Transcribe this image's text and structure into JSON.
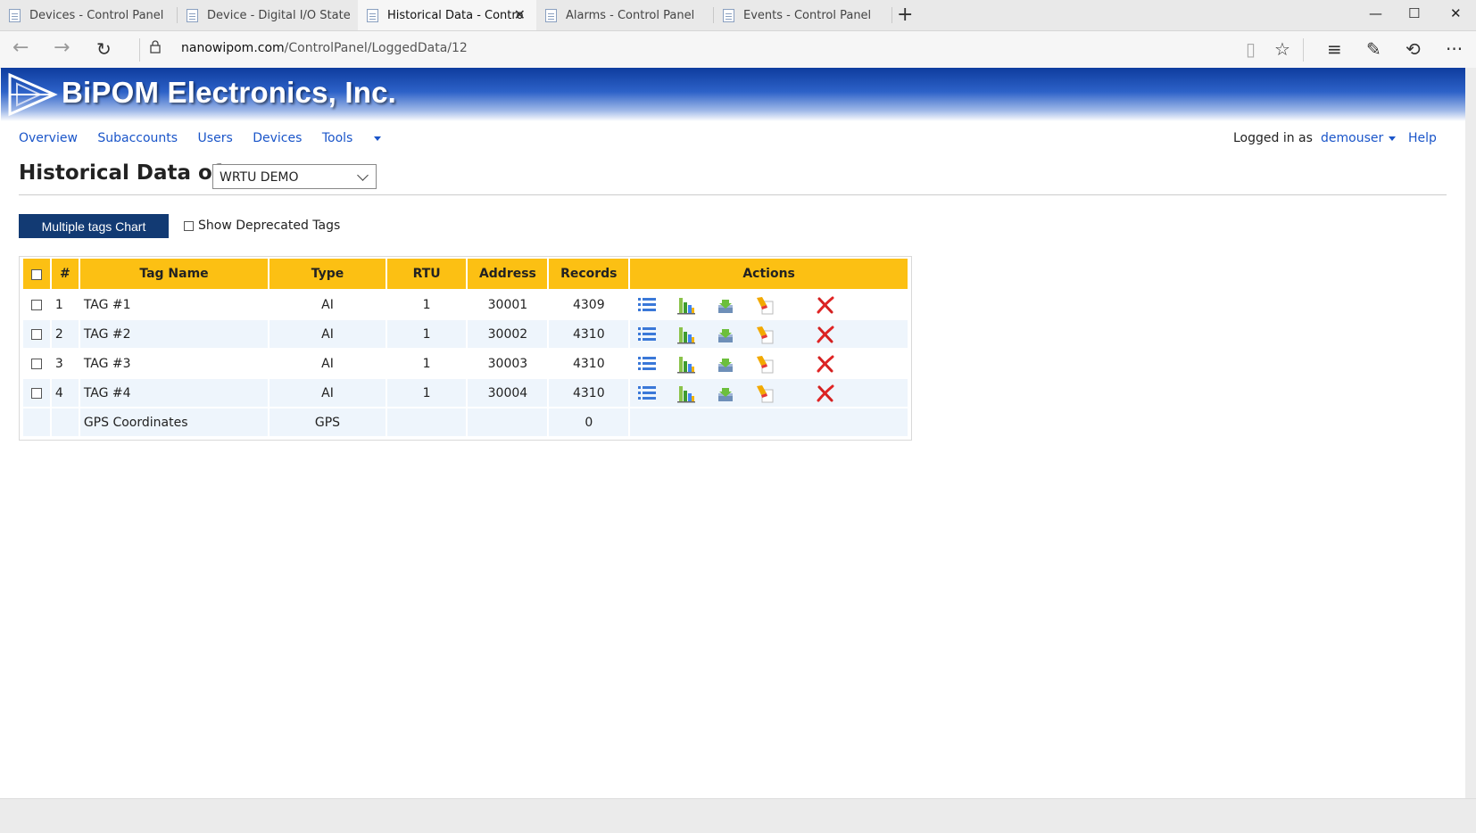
{
  "browser": {
    "tabs": [
      {
        "title": "Devices - Control Panel",
        "active": false
      },
      {
        "title": "Device - Digital I/O State",
        "active": false
      },
      {
        "title": "Historical Data - Contro",
        "active": true
      },
      {
        "title": "Alarms - Control Panel",
        "active": false
      },
      {
        "title": "Events - Control Panel",
        "active": false
      }
    ],
    "url_host": "nanowipom.com",
    "url_path": "/ControlPanel/LoggedData/12"
  },
  "banner": {
    "title": "BiPOM Electronics, Inc.",
    "colors": {
      "dark": "#0e3c9e",
      "mid": "#2d62c8"
    }
  },
  "nav": {
    "items": [
      "Overview",
      "Subaccounts",
      "Users",
      "Devices",
      "Tools"
    ],
    "logged_in_label": "Logged in as",
    "user": "demouser",
    "help": "Help"
  },
  "page": {
    "title": "Historical Data of",
    "device_select": "WRTU DEMO",
    "multi_chart_button": "Multiple tags Chart",
    "deprecated_label": "Show Deprecated Tags"
  },
  "table": {
    "headers": [
      "#",
      "Tag Name",
      "Type",
      "RTU",
      "Address",
      "Records",
      "Actions"
    ],
    "rows": [
      {
        "num": "1",
        "name": "TAG #1",
        "type": "AI",
        "rtu": "1",
        "address": "30001",
        "records": "4309"
      },
      {
        "num": "2",
        "name": "TAG #2",
        "type": "AI",
        "rtu": "1",
        "address": "30002",
        "records": "4310"
      },
      {
        "num": "3",
        "name": "TAG #3",
        "type": "AI",
        "rtu": "1",
        "address": "30003",
        "records": "4310"
      },
      {
        "num": "4",
        "name": "TAG #4",
        "type": "AI",
        "rtu": "1",
        "address": "30004",
        "records": "4310"
      },
      {
        "num": "",
        "name": "GPS Coordinates",
        "type": "GPS",
        "rtu": "",
        "address": "",
        "records": "0"
      }
    ],
    "action_icons": [
      "list-icon",
      "bar-chart-icon",
      "download-icon",
      "clear-icon",
      "delete-icon"
    ],
    "colors": {
      "header": "#fcc013",
      "alt_row": "#eef5fc"
    }
  }
}
